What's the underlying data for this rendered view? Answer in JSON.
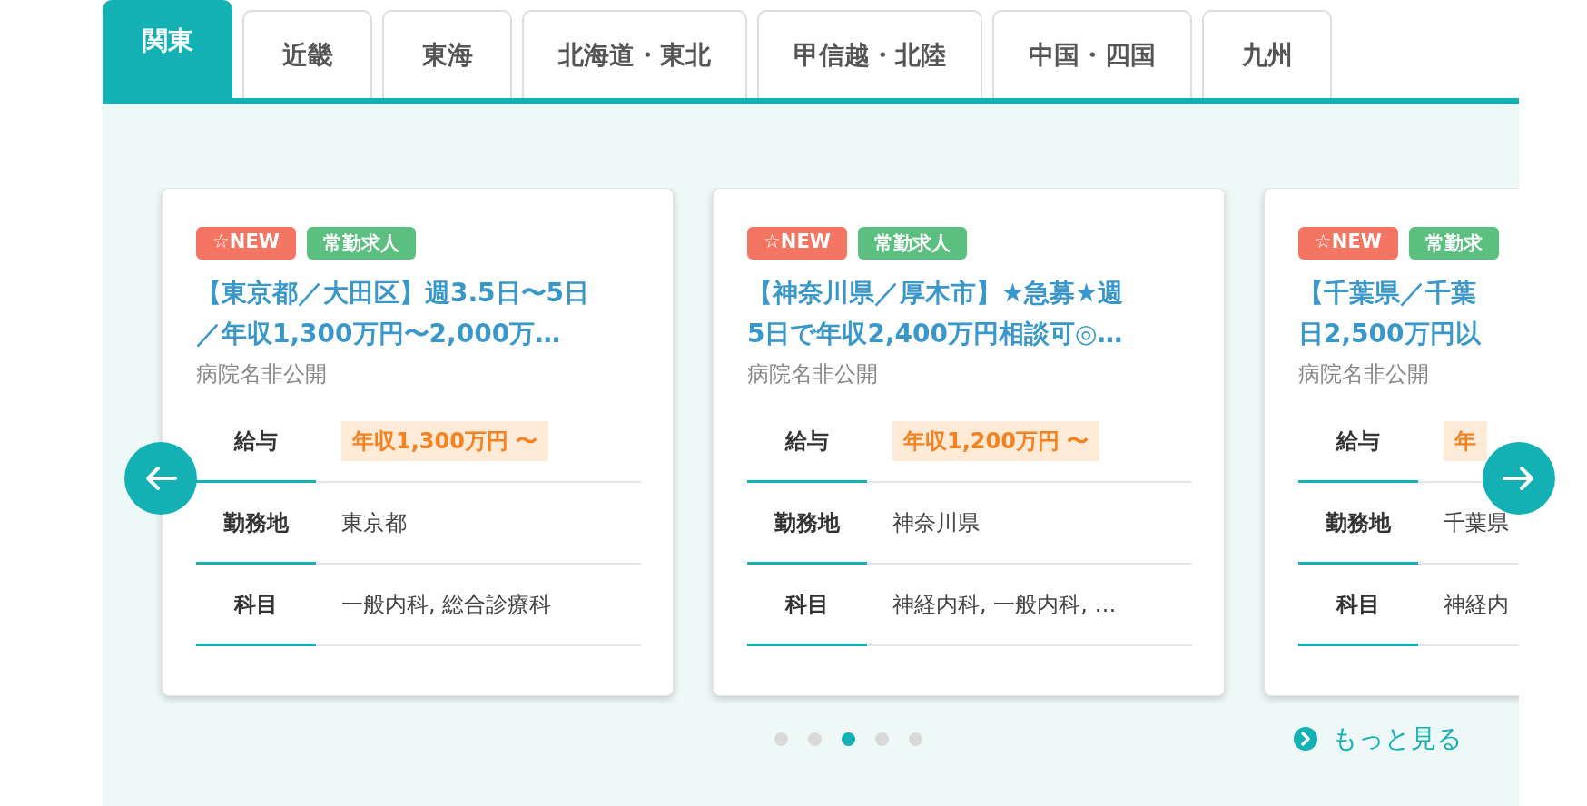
{
  "tabs": [
    {
      "label": "関東",
      "selected": true
    },
    {
      "label": "近畿",
      "selected": false
    },
    {
      "label": "東海",
      "selected": false
    },
    {
      "label": "北海道・東北",
      "selected": false
    },
    {
      "label": "甲信越・北陸",
      "selected": false
    },
    {
      "label": "中国・四国",
      "selected": false
    },
    {
      "label": "九州",
      "selected": false
    }
  ],
  "cards": [
    {
      "tags": [
        {
          "kind": "new",
          "label": "☆NEW"
        },
        {
          "kind": "fulltime",
          "label": "常勤求人"
        }
      ],
      "title_lines": [
        "【東京都／大田区】週3.5日〜5日",
        "／年収1,300万円〜2,000万…"
      ],
      "hospital": "病院名非公開",
      "rows": [
        {
          "kind": "salary",
          "label": "給与",
          "value": "年収1,300万円 〜"
        },
        {
          "kind": "plain",
          "label": "勤務地",
          "value": "東京都"
        },
        {
          "kind": "plain",
          "label": "科目",
          "value": "一般内科, 総合診療科"
        }
      ]
    },
    {
      "tags": [
        {
          "kind": "new",
          "label": "☆NEW"
        },
        {
          "kind": "fulltime",
          "label": "常勤求人"
        }
      ],
      "title_lines": [
        "【神奈川県／厚木市】★急募★週",
        "5日で年収2,400万円相談可◎…"
      ],
      "hospital": "病院名非公開",
      "rows": [
        {
          "kind": "salary",
          "label": "給与",
          "value": "年収1,200万円 〜"
        },
        {
          "kind": "plain",
          "label": "勤務地",
          "value": "神奈川県"
        },
        {
          "kind": "plain",
          "label": "科目",
          "value": "神経内科, 一般内科, …"
        }
      ]
    },
    {
      "tags": [
        {
          "kind": "new",
          "label": "☆NEW"
        },
        {
          "kind": "fulltime",
          "label": "常勤求"
        }
      ],
      "title_lines": [
        "【千葉県／千葉",
        "日2,500万円以"
      ],
      "hospital": "病院名非公開",
      "rows": [
        {
          "kind": "salary",
          "label": "給与",
          "value": "年"
        },
        {
          "kind": "plain",
          "label": "勤務地",
          "value": "千葉県"
        },
        {
          "kind": "plain",
          "label": "科目",
          "value": "神経内"
        }
      ]
    }
  ],
  "dots": [
    {
      "selected": false
    },
    {
      "selected": false
    },
    {
      "selected": true
    },
    {
      "selected": false
    },
    {
      "selected": false
    }
  ],
  "more_link": "もっと見る"
}
